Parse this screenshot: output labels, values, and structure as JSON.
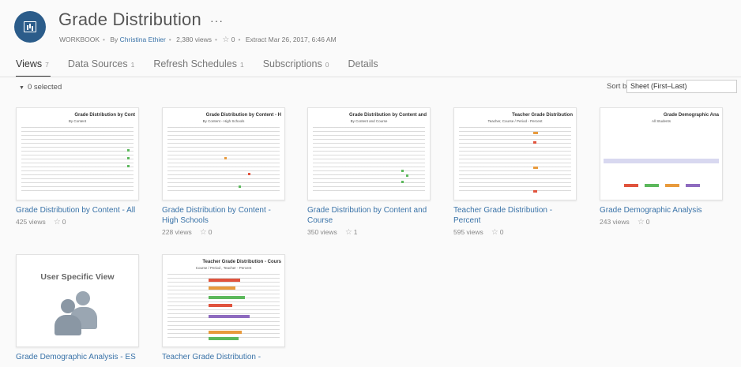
{
  "header": {
    "title": "Grade Distribution",
    "more": "···",
    "type_label": "WORKBOOK",
    "by_label": "By",
    "owner": "Christina Ethier",
    "views": "2,380 views",
    "favorites": "0",
    "extract": "Extract",
    "extract_date": "Mar 26, 2017, 6:46 AM"
  },
  "tabs": [
    {
      "label": "Views",
      "count": "7"
    },
    {
      "label": "Data Sources",
      "count": "1"
    },
    {
      "label": "Refresh Schedules",
      "count": "1"
    },
    {
      "label": "Subscriptions",
      "count": "0"
    },
    {
      "label": "Details",
      "count": ""
    }
  ],
  "toolbar": {
    "selected": "0 selected",
    "sort_label": "Sort by",
    "sort_value": "Sheet (First–Last)"
  },
  "cards": [
    {
      "title": "Grade Distribution by Content - All",
      "views": "425 views",
      "favorites": "0",
      "thumb_title": "Grade Distribution by Cont",
      "thumb_sub": "By Content"
    },
    {
      "title": "Grade Distribution by Content - High Schools",
      "views": "228 views",
      "favorites": "0",
      "thumb_title": "Grade Distribution by Content - H",
      "thumb_sub": "By Content - High Schools"
    },
    {
      "title": "Grade Distribution by Content and Course",
      "views": "350 views",
      "favorites": "1",
      "thumb_title": "Grade Distribution by Content and",
      "thumb_sub": "By Content and Course"
    },
    {
      "title": "Teacher Grade Distribution - Percent",
      "views": "595 views",
      "favorites": "0",
      "thumb_title": "Teacher Grade Distribution",
      "thumb_sub": "Teacher, Course / Period - Percent"
    },
    {
      "title": "Grade Demographic Analysis",
      "views": "243 views",
      "favorites": "0",
      "thumb_title": "Grade Demographic Ana",
      "thumb_sub": "All Students"
    },
    {
      "title": "Grade Demographic Analysis - ES",
      "views": "",
      "favorites": "",
      "thumb_title": "User Specific View",
      "thumb_sub": ""
    },
    {
      "title": "Teacher Grade Distribution - ",
      "views": "",
      "favorites": "",
      "thumb_title": "Teacher Grade Distribution - Cours",
      "thumb_sub": "Course / Period , Teacher - Percent"
    }
  ],
  "colors": {
    "accent": "#3a73a8",
    "icon_bg": "#2b5c8a",
    "tag_green": "#5cb85c",
    "tag_red": "#e0533d",
    "tag_orange": "#e89a3c",
    "tag_purple": "#8e6bbf"
  }
}
